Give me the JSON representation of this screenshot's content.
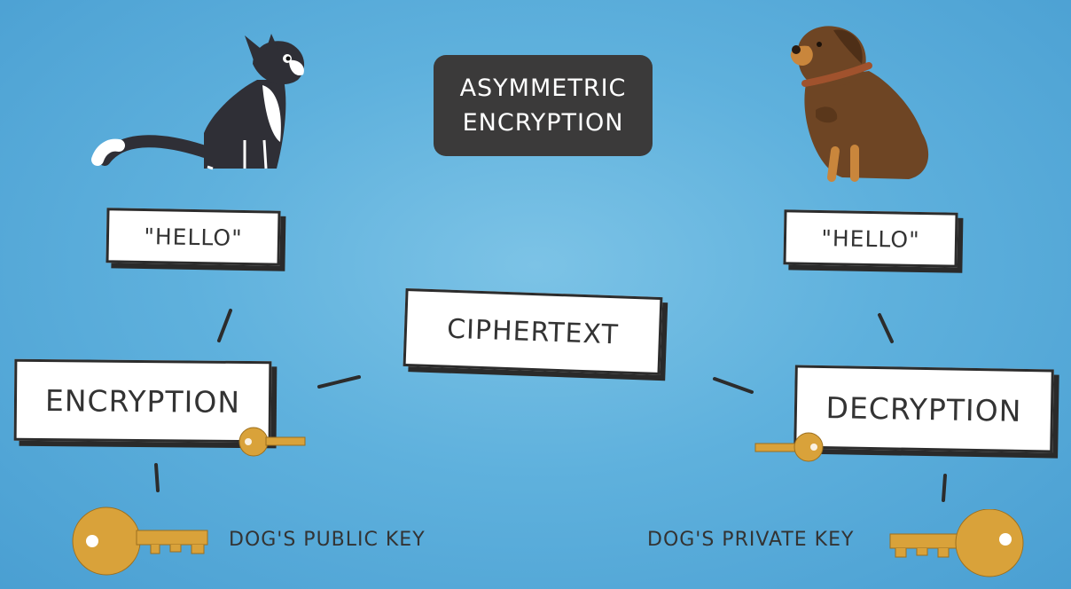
{
  "title": {
    "line1": "ASYMMETRIC",
    "line2": "ENCRYPTION"
  },
  "nodes": {
    "hello_left": "\"HELLO\"",
    "hello_right": "\"HELLO\"",
    "ciphertext": "CIPHERTEXT",
    "encryption": "ENCRYPTION",
    "decryption": "DECRYPTION"
  },
  "captions": {
    "public_key": "DOG'S PUBLIC KEY",
    "private_key": "DOG'S PRIVATE KEY"
  },
  "characters": {
    "sender": "cat",
    "receiver": "dog"
  },
  "colors": {
    "background": "#5fb1dd",
    "key": "#d9a23a",
    "title_bg": "#3b3a3a",
    "box_border": "#2c2c2c"
  }
}
